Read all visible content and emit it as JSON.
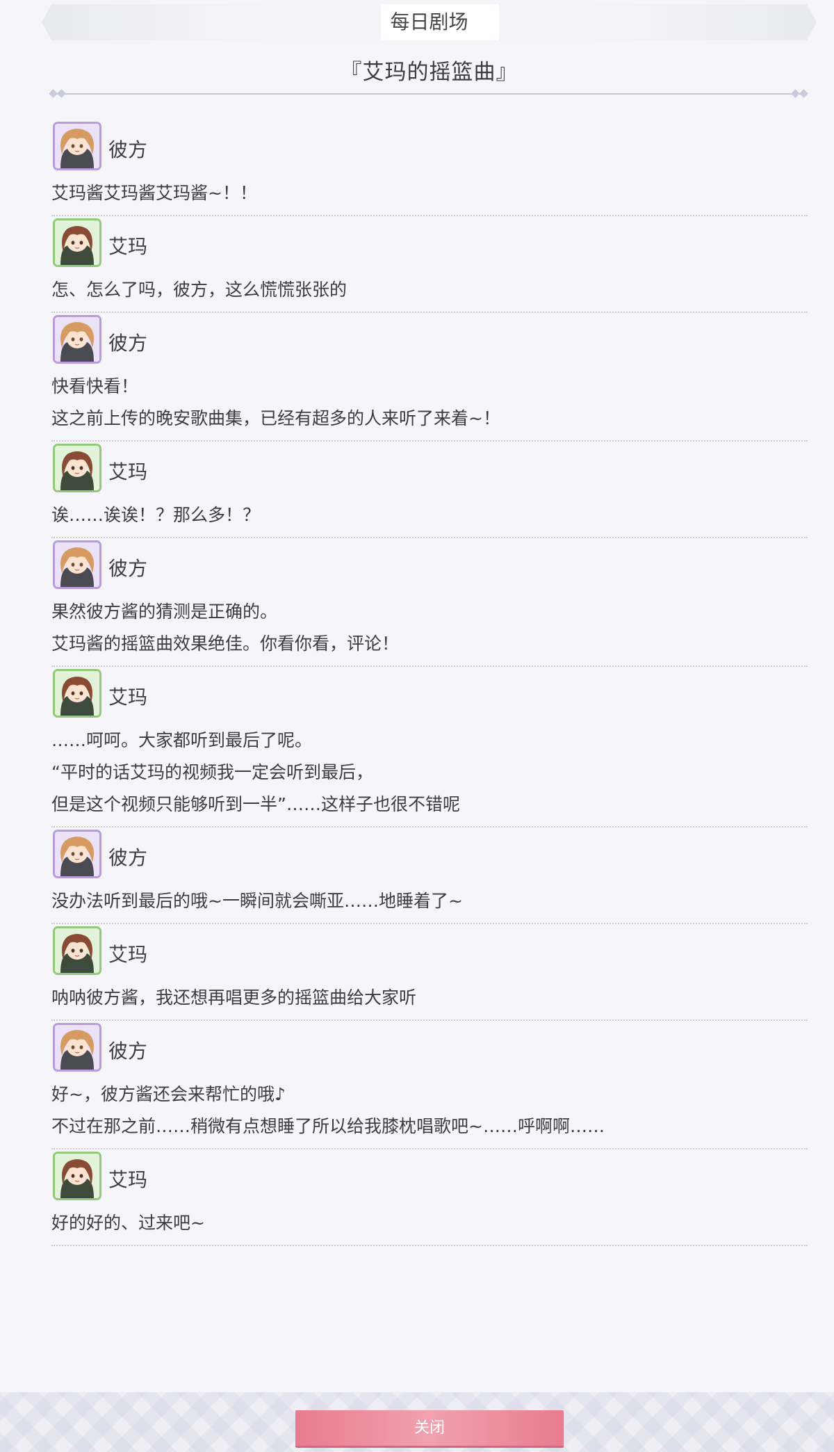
{
  "header": {
    "title": "每日剧场"
  },
  "story": {
    "title": "『艾玛的摇篮曲』"
  },
  "footer": {
    "close_label": "关闭"
  },
  "colors": {
    "kanata_border": "#b89cdb",
    "ema_border": "#92c97a",
    "close_button": "#e87c8f"
  },
  "messages": [
    {
      "speaker": "彼方",
      "avatar": "kanata-avatar",
      "lines": [
        "艾玛酱艾玛酱艾玛酱~！！"
      ]
    },
    {
      "speaker": "艾玛",
      "avatar": "ema-avatar",
      "lines": [
        "怎、怎么了吗，彼方，这么慌慌张张的"
      ]
    },
    {
      "speaker": "彼方",
      "avatar": "kanata-avatar",
      "lines": [
        "快看快看！",
        "这之前上传的晚安歌曲集，已经有超多的人来听了来着~！"
      ]
    },
    {
      "speaker": "艾玛",
      "avatar": "ema-avatar",
      "lines": [
        "诶……诶诶！？那么多！？"
      ]
    },
    {
      "speaker": "彼方",
      "avatar": "kanata-avatar",
      "lines": [
        "果然彼方酱的猜测是正确的。",
        "艾玛酱的摇篮曲效果绝佳。你看你看，评论！"
      ]
    },
    {
      "speaker": "艾玛",
      "avatar": "ema-avatar",
      "lines": [
        "……呵呵。大家都听到最后了呢。",
        "“平时的话艾玛的视频我一定会听到最后，",
        "但是这个视频只能够听到一半”……这样子也很不错呢"
      ]
    },
    {
      "speaker": "彼方",
      "avatar": "kanata-avatar",
      "lines": [
        "没办法听到最后的哦~一瞬间就会嘶亚……地睡着了~"
      ]
    },
    {
      "speaker": "艾玛",
      "avatar": "ema-avatar",
      "lines": [
        "呐呐彼方酱，我还想再唱更多的摇篮曲给大家听"
      ]
    },
    {
      "speaker": "彼方",
      "avatar": "kanata-avatar",
      "lines": [
        "好~，彼方酱还会来帮忙的哦♪",
        "不过在那之前……稍微有点想睡了所以给我膝枕唱歌吧~……呼啊啊……"
      ]
    },
    {
      "speaker": "艾玛",
      "avatar": "ema-avatar",
      "lines": [
        "好的好的、过来吧~"
      ]
    }
  ]
}
